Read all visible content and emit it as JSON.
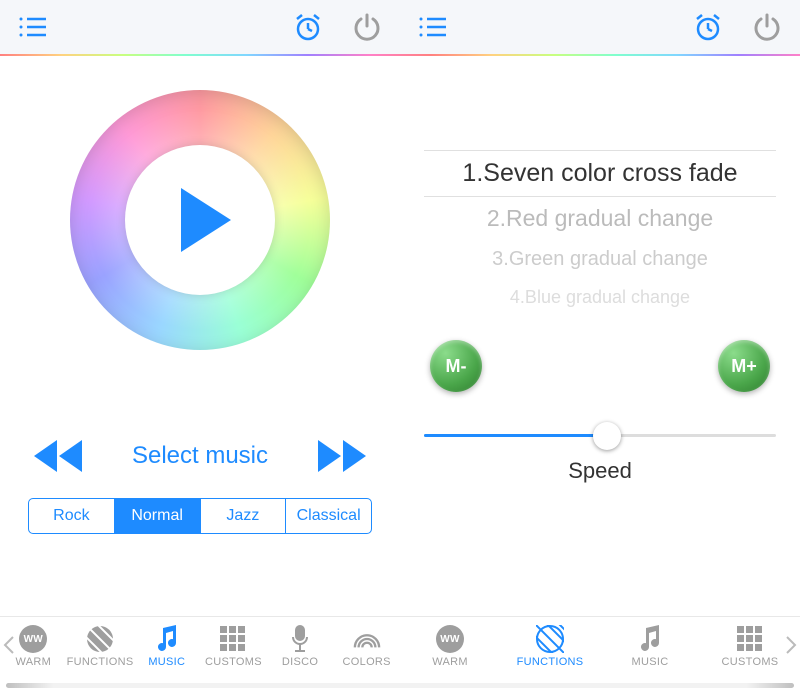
{
  "colors": {
    "accent": "#1E8BFF",
    "green": "#4CAF50"
  },
  "header": {
    "left_icon": "list-icon",
    "alarm_icon": "alarm-icon",
    "power_icon": "power-icon"
  },
  "left": {
    "select_music_label": "Select music",
    "eq": [
      {
        "label": "Rock",
        "active": false
      },
      {
        "label": "Normal",
        "active": true
      },
      {
        "label": "Jazz",
        "active": false
      },
      {
        "label": "Classical",
        "active": false
      }
    ]
  },
  "right": {
    "effects": [
      {
        "label": "1.Seven color cross fade",
        "selected": true
      },
      {
        "label": "2.Red gradual change",
        "selected": false
      },
      {
        "label": "3.Green gradual change",
        "selected": false
      },
      {
        "label": "4.Blue gradual change",
        "selected": false
      }
    ],
    "m_minus": "M-",
    "m_plus": "M+",
    "speed_label": "Speed",
    "speed_value_pct": 52
  },
  "tabs": {
    "left": [
      {
        "id": "warm",
        "label": "WARM",
        "icon": "ww-icon",
        "active": false
      },
      {
        "id": "functions",
        "label": "FUNCTIONS",
        "icon": "hatched-circle-icon",
        "active": false
      },
      {
        "id": "music",
        "label": "MUSIC",
        "icon": "music-note-icon",
        "active": true
      },
      {
        "id": "customs",
        "label": "CUSTOMS",
        "icon": "grid-icon",
        "active": false
      },
      {
        "id": "disco",
        "label": "DISCO",
        "icon": "mic-icon",
        "active": false
      },
      {
        "id": "colors",
        "label": "COLORS",
        "icon": "rainbow-icon",
        "active": false
      }
    ],
    "right": [
      {
        "id": "warm",
        "label": "WARM",
        "icon": "ww-icon",
        "active": false
      },
      {
        "id": "functions",
        "label": "FUNCTIONS",
        "icon": "hatched-circle-icon",
        "active": true
      },
      {
        "id": "music",
        "label": "MUSIC",
        "icon": "music-note-icon",
        "active": false
      },
      {
        "id": "customs",
        "label": "CUSTOMS",
        "icon": "grid-icon",
        "active": false
      }
    ]
  }
}
